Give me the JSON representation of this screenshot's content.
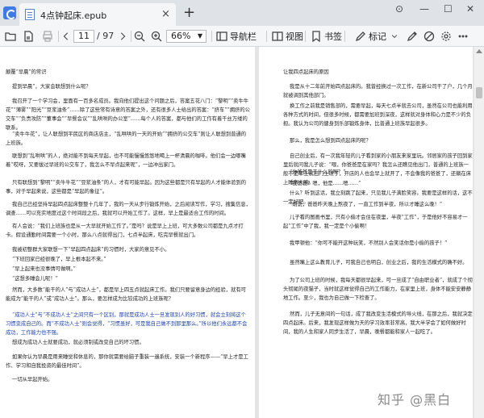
{
  "titlebar": {
    "tab_title": "4点钟起床.epub",
    "tab_close": "×",
    "new_tab": "+",
    "pin": "⊙",
    "minimize": "—",
    "maximize": "☐",
    "close": "✕"
  },
  "toolbar": {
    "current_page": "11",
    "total_pages": "/ 97",
    "zoom": "66%",
    "nav_label": "导航栏",
    "view_label": "视图",
    "bookmark_label": "书签",
    "mark_label": "标记"
  },
  "left_page": {
    "paragraphs": [
      "颠覆“早晨”的常识",
      "    提到早晨”，大家会联想到什么呢？",
      "    我召开了一个学习会，里面有一百多名成员。我向他们提出这个问题之后，答案五花八门：“黎明”“卖牛牛花”“薄雾”“阳光”“豆浆油条”……除了这些常有诗意的答案之外，还有很多人士给出的答案：“挤车”“拥挤的公交车”“负责攻防”“董事会”“早餐会议”“乱哄哄的办公室”……每个人的答案，都与他们的工作有着千丝万缕的联系。",
      "    “卖牛牛花”，让人联想到平民区的商店店主，“乱哄哄的一天的开始”“拥挤的公交车”则让人联想到普通的上班族。",
      "    联想到“乱哄哄”的人，绝对能不到每天早起，也不可能慢慢悠悠地喝上一杯清晨的咖啡。他们会一边哪嘴着“哎呀，又要拔过早班的公交车了，我怎么不早点起来呢”，一边冲出家门。",
      "    只有联想到“黎明”“卖牛牛花”“豆浆油条”的人，才有可能早起。因为这些都是只有早起的人才能体验到的事，对于早起来说，这些都是“早起的象征”。",
      "    我自己已经坚持早起四点起床整整十几年了，我的一天从步行锻炼开始，之后阅读写作，学习，搜集信息，调查……可以充实地度过这个时间段之后，我就可以开始工作了。这样，早上是最适合工作的时间。",
      "    有人会说：“我们上班族也是从一大早就开始工作了。”是吗？说是早上上班，可大多数公司都是九点才打卡。假设通勤时间需要一个小时，那么八点就得出门，七点半起床，吃完早餐就出门。",
      "    我被初整群大家联想一下“早起四点起床”的习惯时，大家的意见不小。",
      "    “下班回家已经很晚了，早上根本起不来。”",
      "    “早上起来也没事情可做啊。”",
      "    “这想多睡会儿呢！”",
      "    然而，大多数“能干的人”与“成功人士”，都是早上四五点就起床工作。我们只要留意身边的经验，就有可能成为“能干的人”或“成功人士”。那么，要怎样成为比较成功的上班族呢？",
      "    “成功人士”与“不成功人士”之间只有一个区别，那就是成功人士一旦发现别人的好习惯，就会立刻将这个习惯变成自己的。而“不成功人士”则会觉得，“习惯虽好，可是我自己做不到那里那么。”所以他们永远都不会成功，工作能力也不强。",
      "    想成为成功人士就要成功，就必须制或改变自己的坏习惯。",
      "    如果你认为早晨是用来睡觉和休息的，那你就需要给脑子重装一遍系统，安装一个新程序——“早上才是工作、学习和自我投资的最佳时间”。",
      "    一切从早起开始。"
    ]
  },
  "right_page": {
    "paragraphs": [
      "让我四点起床的原因",
      "    我是从十二年前开始四点起床的。我曾经换过一次工作，在新公司干了户，几个月就被调到其他部门。",
      "    换工作之前我是销售部的，需要早起，每天七点半就去公司，虽然在公司也能利用各种方式的时间，但很多时候，都需要加班到深夜，这样就对身体和心力是不少的负担。我认为公司的健身到乐部锻炼身体，比普通上班族早起很多。",
      "    那么，我是怎么想到四点起床的呢？",
      "    自己创业后，有一次我年轻的儿子看到家的小朋友来家里玩。邻居家的孩子回到家里后就问我儿子说：“喂，你爸爸是在家吗？我怎么还瞧见他出门，普通的上班族一般不是早上就出门上班了，开店的人也会早上就开了，不会像我的爸爸了，还躺在床上睡声大响。",
      "    “你爸爸是干什么的呢？”",
      "    “我爸爸？嗯，他是……嗯……”",
      "    什么？听到这话，我立刻跳了起来，只见我儿子满脸笑容。我要是这样的话，这不一定好吧。",
      "    “胡说，爸爸昨天晚上熬夜了，一直工作到半夜，所以才睡这么晚！”",
      "    儿子看的图画书里，只有小偷才会住在夜里，半夜“工作”，于是他好不容易才一起“工作”中了我，我一定是个小偷啊！",
      "    我甲顿他：“你可不能开这种玩笑，不然别人会笑话你是小偷的孩子！”",
      "    虽然嘴上这么教育儿子，可我自己也明白，创业之后，我的生活模式的确不好。",
      "    为了公司上班的时候，我每天都很早起来，可一旦成了“自由职业者”，就成了个彻头彻尾的夜猫子，当时就这样觉得自己的工作能力，在家里上班，身体不能安安静静地工作。至少，我也为自己做一下检查了。",
      "    然而，儿子无意间的一句话，成了我改变生活模式的导火线，在那之后，我就决定四点起床。后来，我发现这样做为天的学习效率非常高，我大半学会了如何做好时间，我的人生和家人同步生活了，早晨，晚餐都能和家人一起吃了。"
    ]
  },
  "watermark": "知乎 @黑白"
}
